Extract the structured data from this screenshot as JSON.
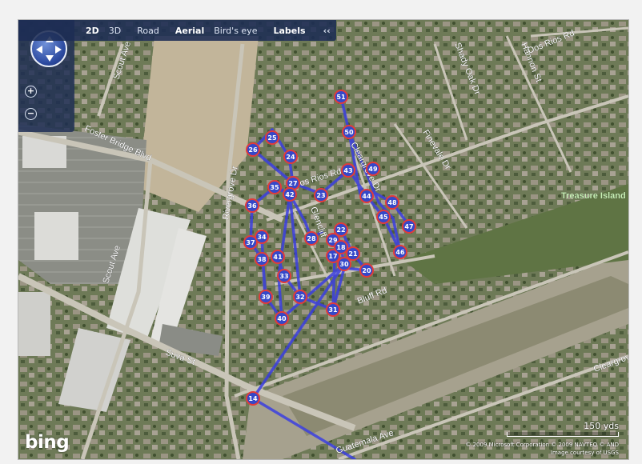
{
  "toolbar": {
    "view_2d": "2D",
    "view_3d": "3D",
    "road": "Road",
    "aerial": "Aerial",
    "birds_eye": "Bird's eye",
    "labels": "Labels",
    "collapse": "‹‹"
  },
  "controls": {
    "zoom_in": "+",
    "zoom_out": "−"
  },
  "streets": {
    "scout_ave_north": "Scout Ave",
    "scout_ave_south": "Scout Ave",
    "foster_bridge": "Foster Bridge Blvd",
    "rivergrove": "Rivergrove Dr",
    "dos_rios_center": "Dos Rios Rd",
    "dos_rios_ne": "Dos Rios Rd",
    "shady_oak": "Shady Oak Dr",
    "hannon": "Hannon St",
    "finevale": "Finevale Dr",
    "cleargrove_north": "Cleargrove Dr",
    "cleargrove_south": "Cleargrove",
    "glencliff": "Glencliff",
    "bluff": "Bluff Rd",
    "suva": "Suva St",
    "guatemala": "Guatemala Ave"
  },
  "places": {
    "treasure_island": "Treasure Island"
  },
  "markers": [
    "14",
    "20",
    "21",
    "22",
    "23",
    "24",
    "25",
    "26",
    "27",
    "28",
    "29",
    "30",
    "31",
    "32",
    "33",
    "34",
    "35",
    "36",
    "37",
    "38",
    "39",
    "40",
    "41",
    "42",
    "43",
    "44",
    "45",
    "46",
    "47",
    "48",
    "49",
    "50",
    "51",
    "17",
    "18"
  ],
  "map": {
    "logo": "bing",
    "scale_label": "150 yds",
    "copyright": "© 2009 Microsoft Corporation   © 2009 NAVTEQ   © AND",
    "image_credit": "Image courtesy of USGS"
  },
  "colors": {
    "route": "#3b3fe0",
    "marker_fill": "#3548c9",
    "marker_ring": "#e23b3b",
    "toolbar_bg": "#1c2c54"
  }
}
